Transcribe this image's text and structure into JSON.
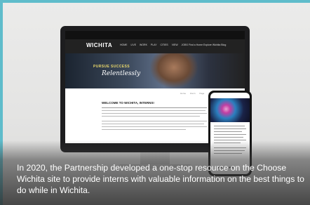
{
  "site": {
    "brand": "WICHITA",
    "nav_items": "HOME  LIVE  WORK  PLAY  CITIES  VIEW  JOBS",
    "nav_right": "Find a Home   Explore Wichita   Blog",
    "hero_line1": "PURSUE SUCCESS",
    "hero_line2": "Relentlessly",
    "breadcrumbs": "Home  Intern  Page  Share",
    "content_heading": "WELCOME TO WICHITA, INTERNS!"
  },
  "phone": {
    "pager": "●●●●●●"
  },
  "caption": "In 2020, the Partnership developed a one-stop resource on the Choose Wichita site to provide interns with valuable information on the best things to do while in Wichita."
}
